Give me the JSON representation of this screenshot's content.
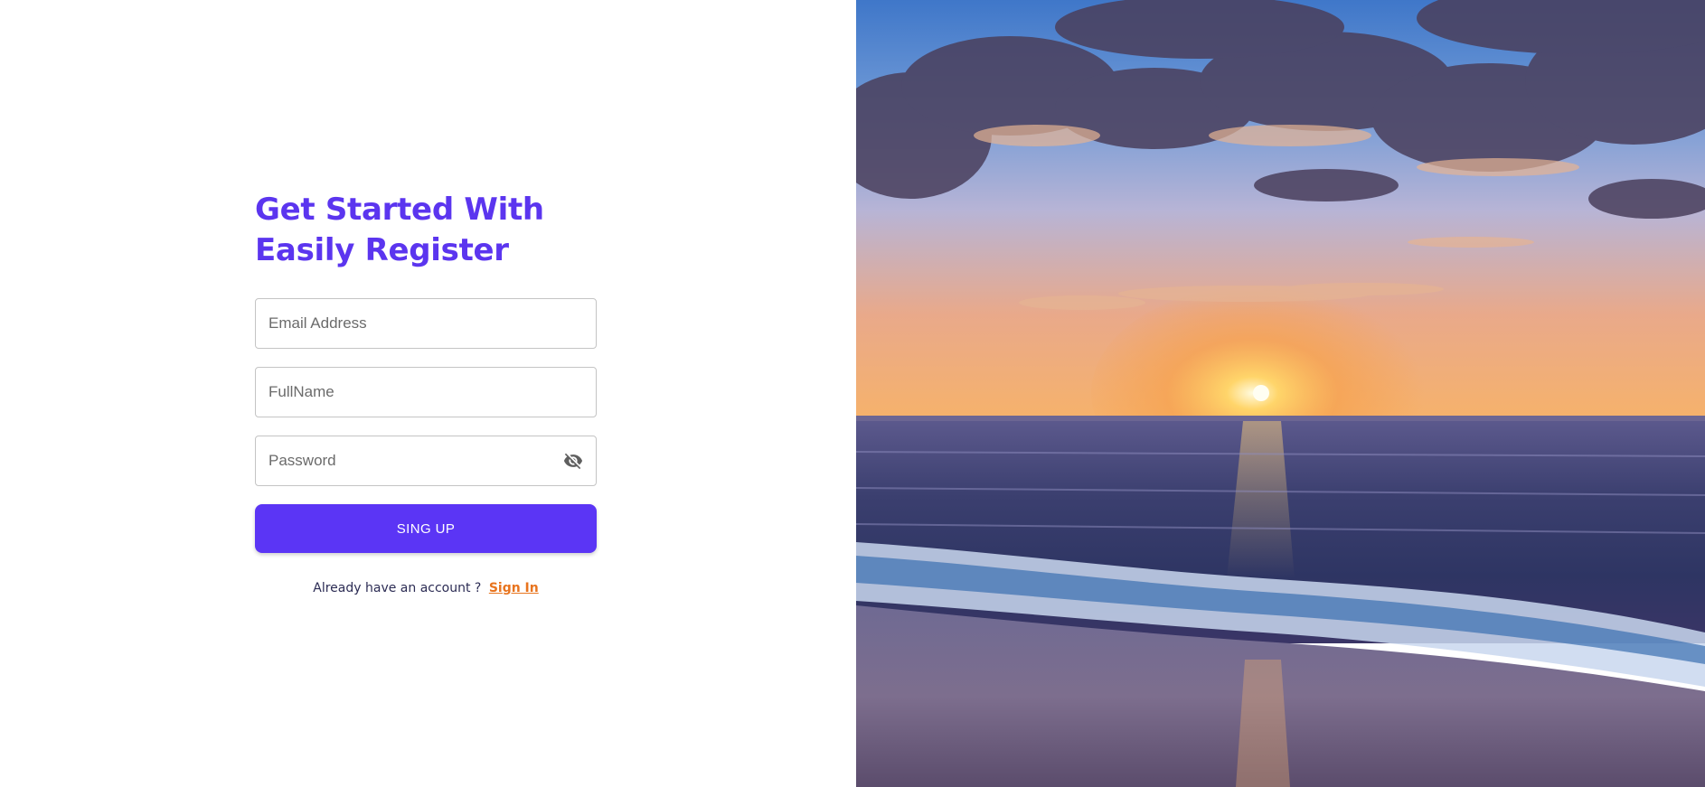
{
  "form": {
    "title": "Get Started With Easily Register",
    "email_placeholder": "Email Address",
    "fullname_placeholder": "FullName",
    "password_placeholder": "Password",
    "submit_label": "SING UP",
    "footer_text": "Already have an account ?",
    "signin_link": "Sign In"
  },
  "colors": {
    "accent": "#5b35f5",
    "link": "#e8741e"
  },
  "icons": {
    "password_toggle": "eye-off-icon"
  },
  "image": {
    "alt": "sunset-over-ocean-beach"
  }
}
